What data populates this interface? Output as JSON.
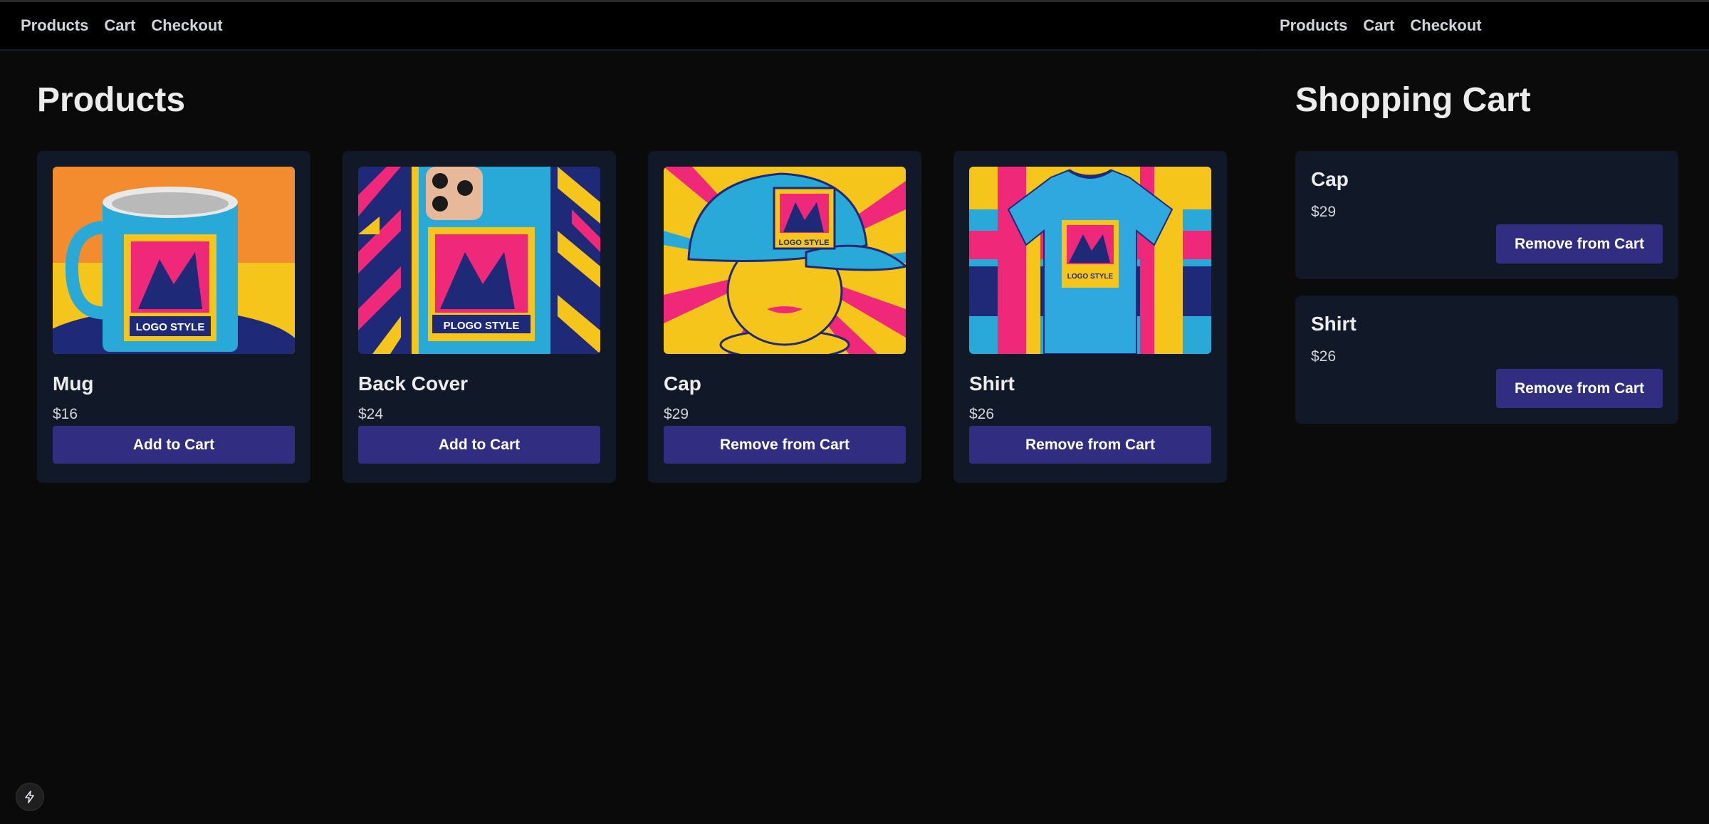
{
  "left": {
    "nav": [
      "Products",
      "Cart",
      "Checkout"
    ],
    "title": "Products",
    "products": [
      {
        "name": "Mug",
        "price": "$16",
        "action": "Add to Cart",
        "image": "mug-image"
      },
      {
        "name": "Back Cover",
        "price": "$24",
        "action": "Add to Cart",
        "image": "phone-cover-image"
      },
      {
        "name": "Cap",
        "price": "$29",
        "action": "Remove from Cart",
        "image": "cap-image"
      },
      {
        "name": "Shirt",
        "price": "$26",
        "action": "Remove from Cart",
        "image": "shirt-image"
      }
    ]
  },
  "right": {
    "nav": [
      "Products",
      "Cart",
      "Checkout"
    ],
    "title": "Shopping Cart",
    "items": [
      {
        "name": "Cap",
        "price": "$29",
        "action": "Remove from Cart"
      },
      {
        "name": "Shirt",
        "price": "$26",
        "action": "Remove from Cart"
      }
    ]
  },
  "colors": {
    "accent": "#312e81",
    "card": "#111827",
    "background": "#0a0a0a",
    "pink": "#f0287a",
    "yellow": "#f5c51b",
    "cyan": "#29a9d8",
    "navy": "#1e2a78"
  },
  "logo_text": {
    "mug": "LOGO STYLE",
    "cover": "PLOGO STYLE",
    "cap": "LOGO STYLE",
    "shirt": "LOGO STYLE"
  },
  "icons": {
    "dev": "bolt-icon"
  }
}
